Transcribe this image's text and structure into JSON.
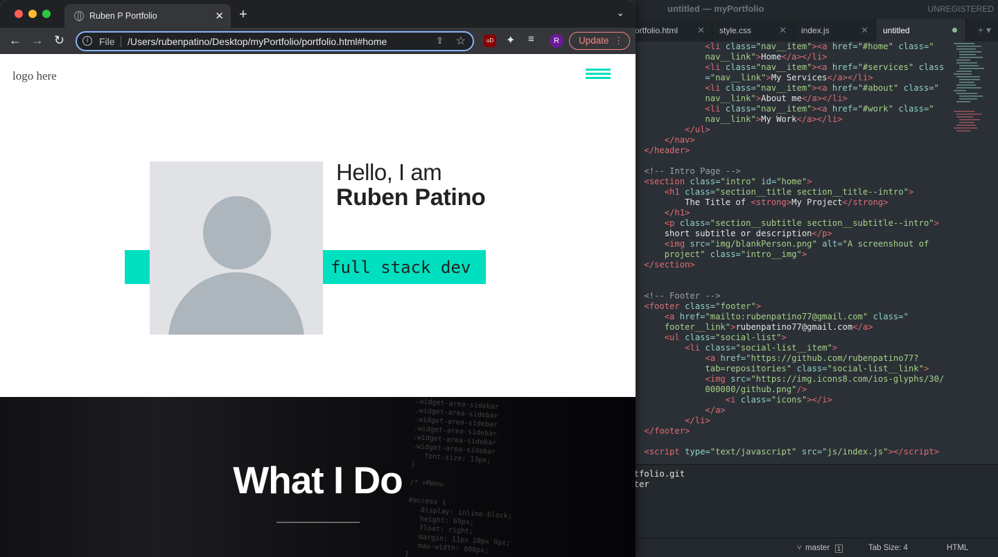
{
  "editor": {
    "window_title": "untitled — myPortfolio",
    "registration": "UNREGISTERED",
    "tabs": [
      {
        "label": "ortfolio.html"
      },
      {
        "label": "style.css"
      },
      {
        "label": "index.js"
      },
      {
        "label": "untitled"
      }
    ],
    "panel_lines": [
      "ortfolio.git",
      "aster"
    ],
    "status": {
      "branch": "master",
      "branch_count": "1",
      "tab_size": "Tab Size: 4",
      "syntax": "HTML"
    }
  },
  "browser": {
    "tab_title": "Ruben P Portfolio",
    "url_scheme": "File",
    "url": "/Users/rubenpatino/Desktop/myPortfolio/portfolio.html#home",
    "update_label": "Update",
    "profile_initial": "R",
    "ublock_label": "uD"
  },
  "page": {
    "logo_alt": "logo here",
    "hello": "Hello, I am",
    "name": "Ruben Patino",
    "subtitle": "full stack dev",
    "section_title": "What I Do"
  },
  "colors": {
    "accent": "#00e0c0",
    "focus_ring": "#8ab4f8",
    "update": "#f28b82"
  }
}
